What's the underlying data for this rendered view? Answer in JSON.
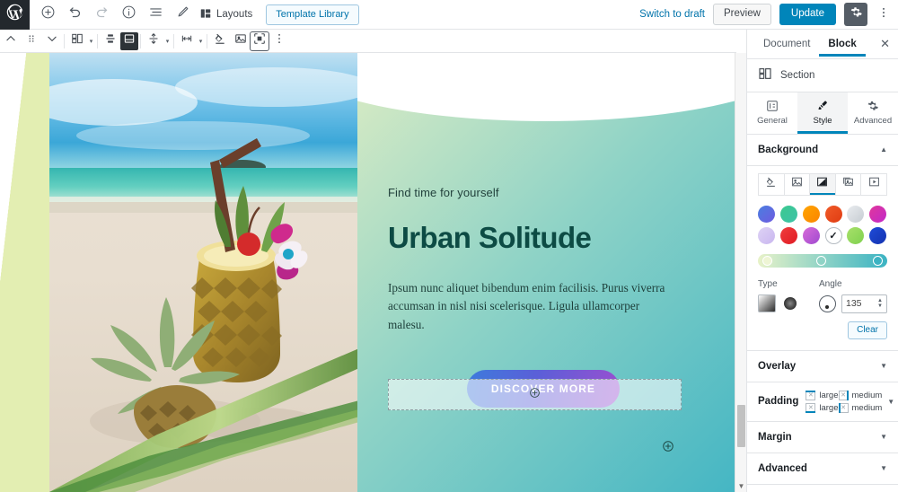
{
  "topbar": {
    "logo_icon": "wordpress-logo",
    "left_icons": [
      {
        "name": "add-block-button",
        "icon": "plus-circle-icon"
      },
      {
        "name": "undo-button",
        "icon": "undo-icon"
      },
      {
        "name": "redo-button",
        "icon": "redo-icon"
      },
      {
        "name": "content-info-button",
        "icon": "info-circle-icon"
      },
      {
        "name": "block-navigation-button",
        "icon": "list-view-icon"
      },
      {
        "name": "edit-mode-button",
        "icon": "pencil-icon"
      }
    ],
    "layouts_label": "Layouts",
    "layouts_icon": "layouts-icon",
    "template_library_label": "Template Library",
    "switch_to_draft_label": "Switch to draft",
    "preview_label": "Preview",
    "update_label": "Update",
    "settings_icon": "gear-icon",
    "more_icon": "kebab-menu-icon"
  },
  "block_toolbar": {
    "items": [
      {
        "name": "move-up-button",
        "icon": "chevron-up-icon"
      },
      {
        "name": "drag-handle",
        "icon": "drag-dots-icon"
      },
      {
        "name": "move-down-button",
        "icon": "chevron-down-icon"
      },
      {
        "name": "layout-button",
        "icon": "columns-layout-icon",
        "has_dropdown": true
      },
      {
        "name": "vertical-align-button",
        "icon": "align-vertical-icon"
      },
      {
        "name": "block-type-button",
        "icon": "section-block-icon",
        "selected": true
      },
      {
        "name": "spacing-button",
        "icon": "vertical-spacing-icon",
        "has_dropdown": true
      },
      {
        "name": "width-button",
        "icon": "horizontal-width-icon",
        "has_dropdown": true
      },
      {
        "name": "color-button",
        "icon": "paint-bucket-icon"
      },
      {
        "name": "media-button",
        "icon": "image-icon"
      },
      {
        "name": "fullwidth-button",
        "icon": "full-width-icon",
        "active": true
      },
      {
        "name": "more-options-button",
        "icon": "kebab-menu-icon"
      }
    ]
  },
  "canvas": {
    "hero": {
      "eyebrow": "Find time for yourself",
      "title": "Urban Solitude",
      "body": "Ipsum nunc aliquet bibendum enim facilisis. Purus viverra accumsan in nisl nisi scelerisque. Ligula ullamcorper malesu.",
      "cta_label": "DISCOVER MORE",
      "cta_gradient_start": "#3d7bdc",
      "cta_gradient_end": "#9a4fd0",
      "background_gradient": "linear-gradient(135deg, #dcecc4, #8fd3c6, #45b6c4)",
      "appender_icon": "plus-circle-icon",
      "block-appender_icon": "plus-circle-icon"
    },
    "photo_alt": "pineapple-cocktail-on-beach"
  },
  "sidebar": {
    "tabs": [
      {
        "label": "Document",
        "active": false
      },
      {
        "label": "Block",
        "active": true
      }
    ],
    "close_icon": "close-icon",
    "block": {
      "icon": "section-block-icon",
      "name": "Section"
    },
    "subtabs": [
      {
        "label": "General",
        "icon": "sliders-icon",
        "active": false
      },
      {
        "label": "Style",
        "icon": "brush-icon",
        "active": true
      },
      {
        "label": "Advanced",
        "icon": "gear-icon",
        "active": false
      }
    ],
    "background": {
      "title": "Background",
      "collapse_icon": "chevron-up-icon",
      "types": [
        {
          "name": "color",
          "icon": "paint-bucket-icon",
          "active": false
        },
        {
          "name": "image",
          "icon": "image-icon",
          "active": false
        },
        {
          "name": "gradient",
          "icon": "gradient-icon",
          "active": true
        },
        {
          "name": "slideshow",
          "icon": "slideshow-icon",
          "active": false
        },
        {
          "name": "video",
          "icon": "video-icon",
          "active": false
        }
      ],
      "swatches": [
        {
          "gradient": "linear-gradient(135deg,#4a7fe0,#6f5ae0)",
          "selected": false
        },
        {
          "gradient": "linear-gradient(135deg,#3bc98f,#3ec2a8)",
          "selected": false
        },
        {
          "gradient": "linear-gradient(135deg,#ffa400,#fb8500)",
          "selected": false
        },
        {
          "gradient": "linear-gradient(135deg,#f05a28,#e03c12)",
          "selected": false
        },
        {
          "gradient": "linear-gradient(135deg,#e9ecef,#c6ccd2)",
          "selected": false
        },
        {
          "gradient": "linear-gradient(135deg,#e0379b,#c229c9)",
          "selected": false
        },
        {
          "gradient": "linear-gradient(135deg,#ded3f5,#c9b6ef)",
          "selected": false
        },
        {
          "gradient": "linear-gradient(135deg,#f03e3e,#e01b24)",
          "selected": false
        },
        {
          "gradient": "linear-gradient(135deg,#d86bd8,#a04ad0)",
          "selected": false
        },
        {
          "gradient": "linear-gradient(135deg,#e8f2c8,#45b6c4)",
          "selected": true
        },
        {
          "gradient": "linear-gradient(135deg,#a8e06a,#7fd14f)",
          "selected": false
        },
        {
          "gradient": "linear-gradient(135deg,#1f4bd8,#1433b0)",
          "selected": false
        }
      ],
      "preview_gradient": "linear-gradient(90deg,#e8f2c8,#8fd3c6,#3bb3c3)",
      "type_label": "Type",
      "type_options": [
        {
          "name": "linear",
          "selected": true
        },
        {
          "name": "radial",
          "selected": false
        }
      ],
      "angle_label": "Angle",
      "angle_value": "135",
      "clear_label": "Clear"
    },
    "panels": [
      {
        "title": "Overlay",
        "chevron": "chevron-down-icon"
      },
      {
        "title": "Margin",
        "chevron": "chevron-down-icon"
      },
      {
        "title": "Advanced",
        "chevron": "chevron-down-icon"
      }
    ],
    "padding": {
      "title": "Padding",
      "values": [
        {
          "side": "top",
          "label": "large"
        },
        {
          "side": "right",
          "label": "medium"
        },
        {
          "side": "bottom",
          "label": "large"
        },
        {
          "side": "left",
          "label": "medium"
        }
      ],
      "chevron": "chevron-down-icon"
    }
  },
  "scrollbar": {
    "arrow_icon": "chevron-down-icon"
  }
}
